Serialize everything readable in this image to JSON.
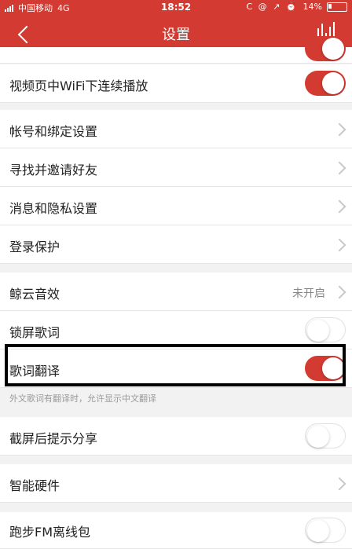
{
  "status": {
    "carrier": "中国移动",
    "network": "4G",
    "time": "18:52",
    "icons": "C @ ↗ ⏰",
    "battery": "14%"
  },
  "nav": {
    "title": "设置"
  },
  "items": [
    {
      "label": "视频页中WiFi下连续播放",
      "toggle": "on"
    },
    {
      "label": "帐号和绑定设置"
    },
    {
      "label": "寻找并邀请好友"
    },
    {
      "label": "消息和隐私设置"
    },
    {
      "label": "登录保护"
    },
    {
      "label": "鲸云音效",
      "value": "未开启"
    },
    {
      "label": "锁屏歌词",
      "toggle": "off"
    },
    {
      "label": "歌词翻译",
      "toggle": "on",
      "note": "外文歌词有翻译时，允许显示中文翻译"
    },
    {
      "label": "截屏后提示分享",
      "toggle": "off"
    },
    {
      "label": "智能硬件"
    },
    {
      "label": "跑步FM离线包",
      "toggle": "off"
    }
  ]
}
